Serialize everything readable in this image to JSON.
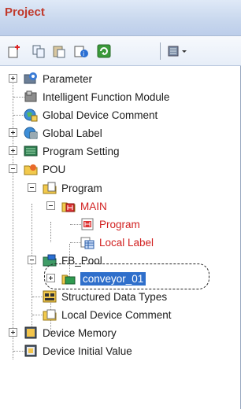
{
  "panel": {
    "title": "Project"
  },
  "toolbar": {
    "buttons": [
      "new-item-icon",
      "copy-icon",
      "paste-icon",
      "properties-icon",
      "refresh-icon",
      "tools-dropdown-icon"
    ]
  },
  "tree": {
    "items": [
      {
        "label": "Parameter",
        "icon": "parameter-icon"
      },
      {
        "label": "Intelligent Function Module",
        "icon": "module-icon"
      },
      {
        "label": "Global Device Comment",
        "icon": "global-comment-icon"
      },
      {
        "label": "Global Label",
        "icon": "global-label-icon"
      },
      {
        "label": "Program Setting",
        "icon": "program-setting-icon"
      },
      {
        "label": "POU",
        "icon": "pou-folder-icon"
      },
      {
        "label": "Program",
        "icon": "program-folder-icon"
      },
      {
        "label": "MAIN",
        "icon": "main-program-icon"
      },
      {
        "label": "Program",
        "icon": "program-file-icon"
      },
      {
        "label": "Local Label",
        "icon": "local-label-icon"
      },
      {
        "label": "FB_Pool",
        "icon": "fb-pool-icon"
      },
      {
        "label": "conveyor_01",
        "icon": "function-block-icon"
      },
      {
        "label": "Structured Data Types",
        "icon": "structured-data-icon"
      },
      {
        "label": "Local Device Comment",
        "icon": "local-comment-icon"
      },
      {
        "label": "Device Memory",
        "icon": "device-memory-icon"
      },
      {
        "label": "Device Initial Value",
        "icon": "device-initial-value-icon"
      }
    ]
  }
}
